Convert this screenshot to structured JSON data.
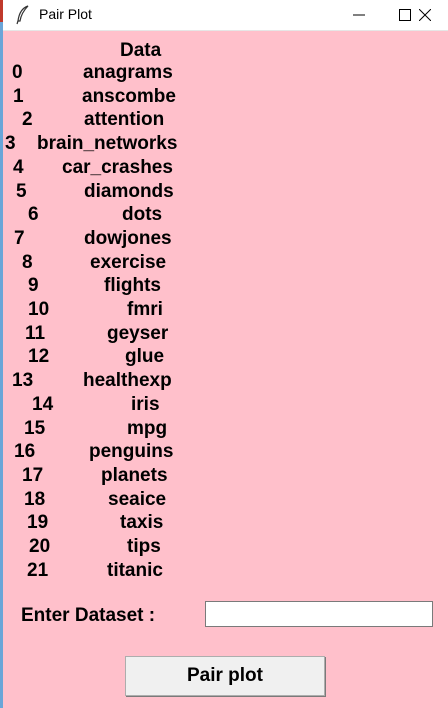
{
  "window": {
    "title": "Pair Plot",
    "app_icon": "feather-icon",
    "controls": [
      "minimize-icon",
      "maximize-icon",
      "close-icon"
    ]
  },
  "table": {
    "header": "Data",
    "rows": [
      {
        "index": "0",
        "name": "anagrams"
      },
      {
        "index": "1",
        "name": "anscombe"
      },
      {
        "index": "2",
        "name": "attention"
      },
      {
        "index": "3",
        "name": "brain_networks"
      },
      {
        "index": "4",
        "name": "car_crashes"
      },
      {
        "index": "5",
        "name": "diamonds"
      },
      {
        "index": "6",
        "name": "dots"
      },
      {
        "index": "7",
        "name": "dowjones"
      },
      {
        "index": "8",
        "name": "exercise"
      },
      {
        "index": "9",
        "name": "flights"
      },
      {
        "index": "10",
        "name": "fmri"
      },
      {
        "index": "11",
        "name": "geyser"
      },
      {
        "index": "12",
        "name": "glue"
      },
      {
        "index": "13",
        "name": "healthexp"
      },
      {
        "index": "14",
        "name": "iris"
      },
      {
        "index": "15",
        "name": "mpg"
      },
      {
        "index": "16",
        "name": "penguins"
      },
      {
        "index": "17",
        "name": "planets"
      },
      {
        "index": "18",
        "name": "seaice"
      },
      {
        "index": "19",
        "name": "taxis"
      },
      {
        "index": "20",
        "name": "tips"
      },
      {
        "index": "21",
        "name": "titanic"
      }
    ]
  },
  "form": {
    "label": "Enter Dataset :",
    "input_value": "",
    "button_label": "Pair plot"
  },
  "colors": {
    "background": "#ffc0cb",
    "titlebar": "#ffffff",
    "button": "#f0f0f0"
  }
}
